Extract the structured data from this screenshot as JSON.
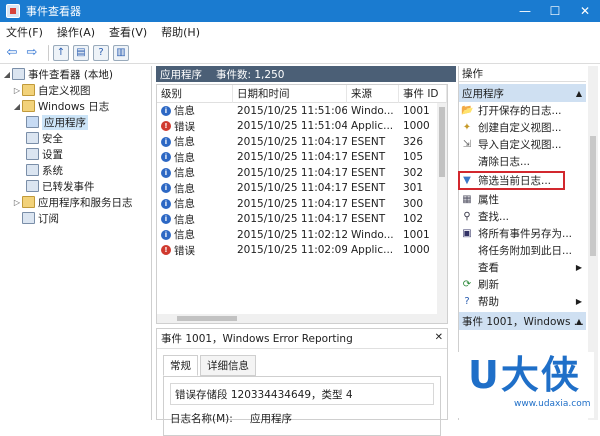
{
  "window": {
    "title": "事件查看器",
    "min": "—",
    "max": "☐",
    "close": "✕"
  },
  "menu": [
    "文件(F)",
    "操作(A)",
    "查看(V)",
    "帮助(H)"
  ],
  "tree": {
    "root": "事件查看器 (本地)",
    "custom_views": "自定义视图",
    "windows_logs": "Windows 日志",
    "app": "应用程序",
    "security": "安全",
    "setup": "设置",
    "system": "系统",
    "forwarded": "已转发事件",
    "app_services": "应用程序和服务日志",
    "subscriptions": "订阅"
  },
  "center": {
    "header_name": "应用程序",
    "header_count": "事件数: 1,250",
    "columns": [
      "级别",
      "日期和时间",
      "来源",
      "事件 ID"
    ],
    "rows": [
      {
        "level": "信息",
        "type": "info",
        "date": "2015/10/25 11:51:06",
        "source": "Windo...",
        "id": "1001"
      },
      {
        "level": "错误",
        "type": "err",
        "date": "2015/10/25 11:51:04",
        "source": "Applic...",
        "id": "1000"
      },
      {
        "level": "信息",
        "type": "info",
        "date": "2015/10/25 11:04:17",
        "source": "ESENT",
        "id": "326"
      },
      {
        "level": "信息",
        "type": "info",
        "date": "2015/10/25 11:04:17",
        "source": "ESENT",
        "id": "105"
      },
      {
        "level": "信息",
        "type": "info",
        "date": "2015/10/25 11:04:17",
        "source": "ESENT",
        "id": "302"
      },
      {
        "level": "信息",
        "type": "info",
        "date": "2015/10/25 11:04:17",
        "source": "ESENT",
        "id": "301"
      },
      {
        "level": "信息",
        "type": "info",
        "date": "2015/10/25 11:04:17",
        "source": "ESENT",
        "id": "300"
      },
      {
        "level": "信息",
        "type": "info",
        "date": "2015/10/25 11:04:17",
        "source": "ESENT",
        "id": "102"
      },
      {
        "level": "信息",
        "type": "info",
        "date": "2015/10/25 11:02:12",
        "source": "Windo...",
        "id": "1001"
      },
      {
        "level": "错误",
        "type": "err",
        "date": "2015/10/25 11:02:09",
        "source": "Applic...",
        "id": "1000"
      }
    ]
  },
  "detail": {
    "title": "事件 1001，Windows Error Reporting",
    "close": "✕",
    "tab_general": "常规",
    "tab_details": "详细信息",
    "text": "错误存储段 120334434649，类型 4",
    "log_label": "日志名称(M):",
    "log_value": "应用程序"
  },
  "actions": {
    "title": "操作",
    "section1": "应用程序",
    "items": [
      {
        "label": "打开保存的日志...",
        "icon": "folder-open"
      },
      {
        "label": "创建自定义视图...",
        "icon": "filter-star"
      },
      {
        "label": "导入自定义视图...",
        "icon": "import"
      },
      {
        "label": "清除日志...",
        "icon": "none"
      },
      {
        "label": "筛选当前日志...",
        "icon": "funnel"
      },
      {
        "label": "属性",
        "icon": "properties"
      },
      {
        "label": "查找...",
        "icon": "find"
      },
      {
        "label": "将所有事件另存为...",
        "icon": "save"
      },
      {
        "label": "将任务附加到此日...",
        "icon": "none"
      },
      {
        "label": "查看",
        "icon": "none"
      },
      {
        "label": "刷新",
        "icon": "refresh"
      },
      {
        "label": "帮助",
        "icon": "help"
      }
    ],
    "section2": "事件 1001，Windows ..."
  },
  "watermark": {
    "logo": "U大侠",
    "url": "www.udaxia.com"
  },
  "colors": {
    "titlebar": "#1a7bd0",
    "highlight": "#d2282e",
    "pane_header": "#4b5f76"
  }
}
